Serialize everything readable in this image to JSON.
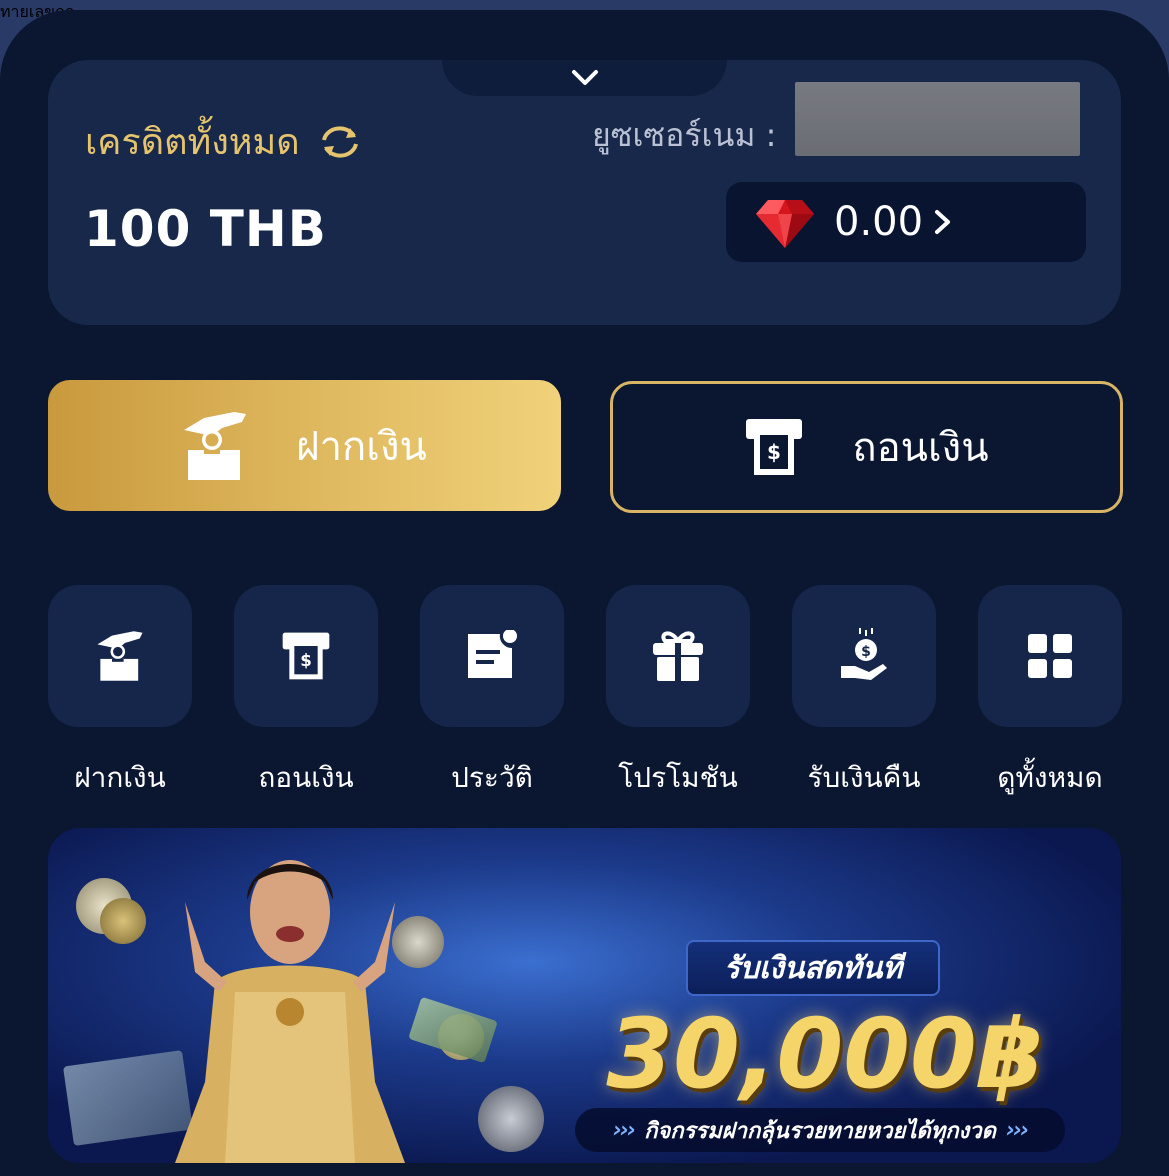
{
  "credit": {
    "label": "เครดิตทั้งหมด",
    "amount": "100 THB",
    "refresh_icon": "refresh-icon"
  },
  "user": {
    "username_label": "ยูซเซอร์เนม :",
    "gem_value": "0.00"
  },
  "actions": {
    "deposit_label": "ฝากเงิน",
    "withdraw_label": "ถอนเงิน"
  },
  "menu": [
    {
      "label": "ฝากเงิน",
      "icon": "deposit-icon"
    },
    {
      "label": "ถอนเงิน",
      "icon": "withdraw-icon"
    },
    {
      "label": "ประวัติ",
      "icon": "history-icon"
    },
    {
      "label": "โปรโมชัน",
      "icon": "gift-icon"
    },
    {
      "label": "รับเงินคืน",
      "icon": "cashback-icon"
    },
    {
      "label": "ดูทั้งหมด",
      "icon": "grid-icon"
    }
  ],
  "banner": {
    "headline": "ทายเลขถูก",
    "subhead": "รับเงินสดทันที",
    "amount": "30,000฿",
    "footer": "กิจกรรมฝากลุ้นรวยทายหวยได้ทุกงวด"
  },
  "colors": {
    "background": "#0b1630",
    "card": "#16264a",
    "gold": "#e6c46e",
    "accent_border": "#d8b565"
  }
}
